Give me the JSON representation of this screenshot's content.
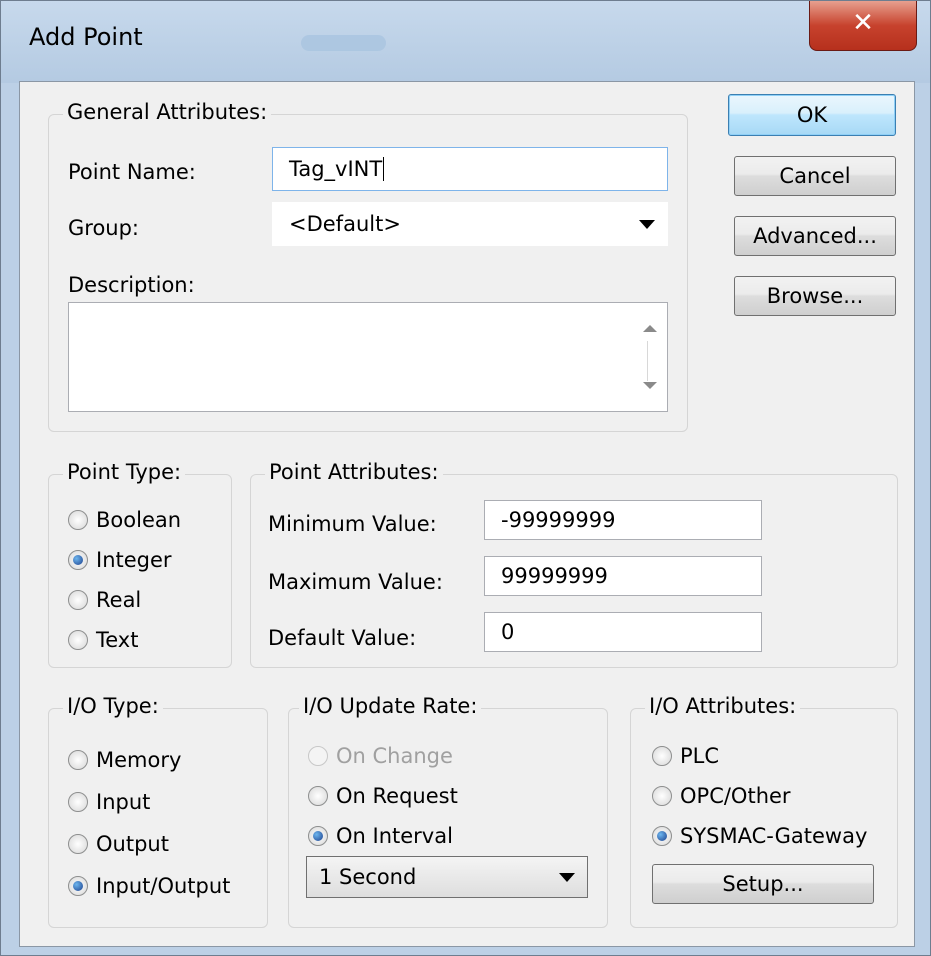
{
  "window": {
    "title": "Add Point",
    "close_glyph": "✕"
  },
  "general": {
    "legend": "General Attributes:",
    "point_name_label": "Point Name:",
    "point_name_value": "Tag_vINT",
    "group_label": "Group:",
    "group_value": "<Default>",
    "description_label": "Description:",
    "description_value": ""
  },
  "buttons": {
    "ok": "OK",
    "cancel": "Cancel",
    "advanced": "Advanced...",
    "browse": "Browse...",
    "setup": "Setup..."
  },
  "point_type": {
    "legend": "Point Type:",
    "options": [
      "Boolean",
      "Integer",
      "Real",
      "Text"
    ],
    "selected": "Integer"
  },
  "point_attributes": {
    "legend": "Point Attributes:",
    "min_label": "Minimum Value:",
    "min_value": "-99999999",
    "max_label": "Maximum Value:",
    "max_value": "99999999",
    "default_label": "Default Value:",
    "default_value": "0"
  },
  "io_type": {
    "legend": "I/O Type:",
    "options": [
      "Memory",
      "Input",
      "Output",
      "Input/Output"
    ],
    "selected": "Input/Output"
  },
  "io_update_rate": {
    "legend": "I/O Update Rate:",
    "options": [
      "On Change",
      "On Request",
      "On Interval"
    ],
    "selected": "On Interval",
    "disabled": [
      "On Change"
    ],
    "interval_value": "1 Second"
  },
  "io_attributes": {
    "legend": "I/O Attributes:",
    "options": [
      "PLC",
      "OPC/Other",
      "SYSMAC-Gateway"
    ],
    "selected": "SYSMAC-Gateway"
  },
  "icons": {
    "close": "close-icon",
    "dropdown": "chevron-down-icon",
    "scroll_up": "scroll-up-icon",
    "scroll_down": "scroll-down-icon"
  }
}
